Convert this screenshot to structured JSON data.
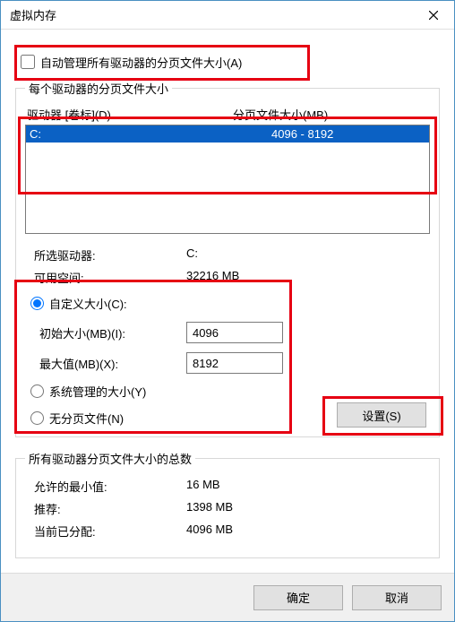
{
  "window": {
    "title": "虚拟内存"
  },
  "auto_manage": {
    "label": "自动管理所有驱动器的分页文件大小(A)",
    "checked": false
  },
  "per_drive": {
    "legend": "每个驱动器的分页文件大小",
    "header_drive": "驱动器 [卷标](D)",
    "header_size": "分页文件大小(MB)",
    "rows": [
      {
        "drive": "C:",
        "size": "4096 - 8192",
        "selected": true
      }
    ],
    "selected_drive_label": "所选驱动器:",
    "selected_drive_value": "C:",
    "avail_label": "可用空间:",
    "avail_value": "32216 MB",
    "custom": {
      "label": "自定义大小(C):",
      "checked": true
    },
    "initial": {
      "label": "初始大小(MB)(I):",
      "value": "4096"
    },
    "max": {
      "label": "最大值(MB)(X):",
      "value": "8192"
    },
    "system_managed": {
      "label": "系统管理的大小(Y)",
      "checked": false
    },
    "no_paging": {
      "label": "无分页文件(N)",
      "checked": false
    },
    "set_button": "设置(S)"
  },
  "totals": {
    "legend": "所有驱动器分页文件大小的总数",
    "min_label": "允许的最小值:",
    "min_value": "16 MB",
    "rec_label": "推荐:",
    "rec_value": "1398 MB",
    "alloc_label": "当前已分配:",
    "alloc_value": "4096 MB"
  },
  "footer": {
    "ok": "确定",
    "cancel": "取消"
  }
}
